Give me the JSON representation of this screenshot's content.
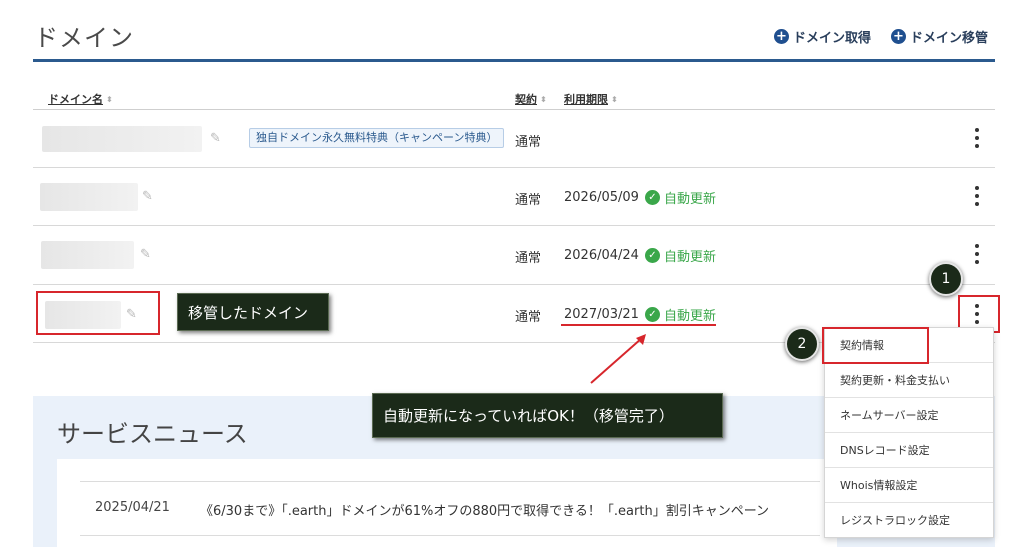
{
  "header": {
    "title": "ドメイン",
    "actions": [
      {
        "label": "ドメイン取得",
        "icon": "plus-circle-icon"
      },
      {
        "label": "ドメイン移管",
        "icon": "plus-circle-icon"
      }
    ]
  },
  "table": {
    "columns": [
      {
        "label": "ドメイン名"
      },
      {
        "label": "契約"
      },
      {
        "label": "利用期限"
      }
    ],
    "rows": [
      {
        "promo_tag": "独自ドメイン永久無料特典（キャンペーン特典）",
        "contract": "通常",
        "expiry": "",
        "auto_renew": ""
      },
      {
        "promo_tag": "",
        "contract": "通常",
        "expiry": "2026/05/09",
        "auto_renew": "自動更新"
      },
      {
        "promo_tag": "",
        "contract": "通常",
        "expiry": "2026/04/24",
        "auto_renew": "自動更新"
      },
      {
        "promo_tag": "",
        "contract": "通常",
        "expiry": "2027/03/21",
        "auto_renew": "自動更新"
      }
    ]
  },
  "annotations": {
    "transferred_label": "移管したドメイン",
    "ok_message": "自動更新になっていればOK！（移管完了）",
    "step1": "1",
    "step2": "2",
    "accent_color": "#d7262c"
  },
  "context_menu": {
    "items": [
      "契約情報",
      "契約更新・料金支払い",
      "ネームサーバー設定",
      "DNSレコード設定",
      "Whois情報設定",
      "レジストラロック設定"
    ]
  },
  "news": {
    "title": "サービスニュース",
    "items": [
      {
        "date": "2025/04/21",
        "text": "《6/30まで》「.earth」ドメインが61%オフの880円で取得できる！「.earth」割引キャンペーン"
      }
    ]
  }
}
